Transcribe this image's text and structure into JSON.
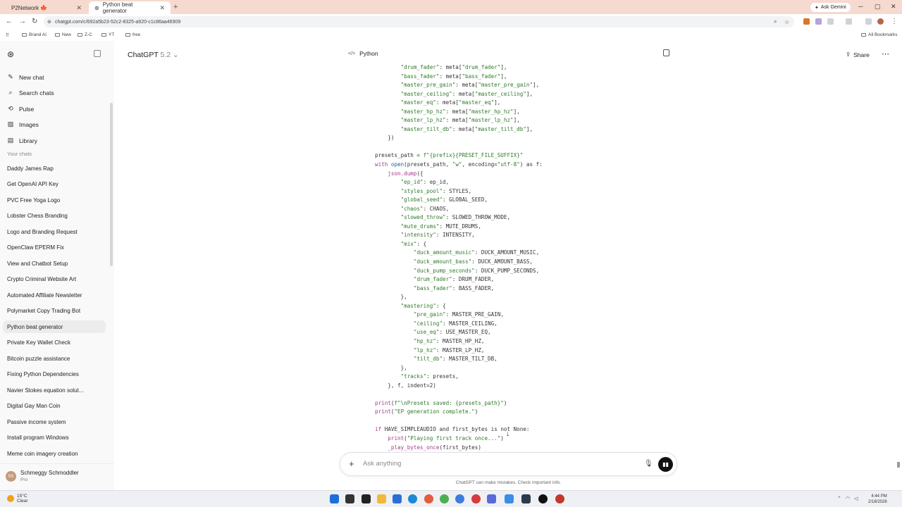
{
  "browser": {
    "tabs": [
      {
        "label": "P2Network 🍁",
        "active": false
      },
      {
        "label": "Python beat generator",
        "active": true
      }
    ],
    "url": "chatgpt.com/c/692a5b23-52c2-8325-a920-c1c86aa46909",
    "ask_gemini": "Ask Gemini",
    "bookmarks": [
      "Brand AI",
      "New",
      "Z-C",
      "YT",
      "free"
    ],
    "all_bookmarks": "All Bookmarks",
    "accent": "#f6d9cf"
  },
  "sidebar": {
    "nav": [
      {
        "label": "New chat",
        "icon": "edit-icon"
      },
      {
        "label": "Search chats",
        "icon": "search-icon"
      },
      {
        "label": "Pulse",
        "icon": "pulse-icon"
      },
      {
        "label": "Images",
        "icon": "image-icon"
      },
      {
        "label": "Library",
        "icon": "library-icon"
      }
    ],
    "section_label": "Your chats",
    "chats": [
      "Daddy James Rap",
      "Get OpenAI API Key",
      "PVC Free Yoga Logo",
      "Lobster Chess Branding",
      "Logo and Branding Request",
      "OpenClaw EPERM Fix",
      "View and Chatbot Setup",
      "Crypto Criminal Website Art",
      "Automated Affiliate Newsletter",
      "Polymarket Copy Trading Bot",
      "Python beat generator",
      "Private Key Wallet Check",
      "Bitcoin puzzle assistance",
      "Fixing Python Dependencies",
      "Navier Stokes equation solut...",
      "Digital Gay Man Coin",
      "Passive income system",
      "Install program Windows",
      "Meme coin imagery creation"
    ],
    "selected_chat": "Python beat generator",
    "user": {
      "name": "Schmeggy Schmoddler",
      "plan": "Pro",
      "initials": "SS"
    }
  },
  "header": {
    "model_name": "ChatGPT",
    "model_version": "5.2",
    "share_label": "Share"
  },
  "code_block": {
    "language": "Python",
    "lines": [
      "        \"drum_fader\": meta[\"drum_fader\"],",
      "        \"bass_fader\": meta[\"bass_fader\"],",
      "        \"master_pre_gain\": meta[\"master_pre_gain\"],",
      "        \"master_ceiling\": meta[\"master_ceiling\"],",
      "        \"master_eq\": meta[\"master_eq\"],",
      "        \"master_hp_hz\": meta[\"master_hp_hz\"],",
      "        \"master_lp_hz\": meta[\"master_lp_hz\"],",
      "        \"master_tilt_db\": meta[\"master_tilt_db\"],",
      "    })",
      "",
      "presets_path = f\"{prefix}{PRESET_FILE_SUFFIX}\"",
      "with open(presets_path, \"w\", encoding=\"utf-8\") as f:",
      "    json.dump({",
      "        \"ep_id\": ep_id,",
      "        \"styles_pool\": STYLES,",
      "        \"global_seed\": GLOBAL_SEED,",
      "        \"chaos\": CHAOS,",
      "        \"slowed_throw\": SLOWED_THROW_MODE,",
      "        \"mute_drums\": MUTE_DRUMS,",
      "        \"intensity\": INTENSITY,",
      "        \"mix\": {",
      "            \"duck_amount_music\": DUCK_AMOUNT_MUSIC,",
      "            \"duck_amount_bass\": DUCK_AMOUNT_BASS,",
      "            \"duck_pump_seconds\": DUCK_PUMP_SECONDS,",
      "            \"drum_fader\": DRUM_FADER,",
      "            \"bass_fader\": BASS_FADER,",
      "        },",
      "        \"mastering\": {",
      "            \"pre_gain\": MASTER_PRE_GAIN,",
      "            \"ceiling\": MASTER_CEILING,",
      "            \"use_eq\": USE_MASTER_EQ,",
      "            \"hp_hz\": MASTER_HP_HZ,",
      "            \"lp_hz\": MASTER_LP_HZ,",
      "            \"tilt_db\": MASTER_TILT_DB,",
      "        },",
      "        \"tracks\": presets,",
      "    }, f, indent=2)",
      "",
      "print(f\"\\nPresets saved: {presets_path}\")",
      "print(\"EP generation complete.\")",
      "",
      "if HAVE_SIMPLEAUDIO and first_bytes is not None:",
      "    print(\"Playing first track once...\")",
      "    _play_bytes_once(first_bytes)"
    ]
  },
  "composer": {
    "placeholder": "Ask anything",
    "disclaimer": "ChatGPT can make mistakes. Check important info."
  },
  "taskbar": {
    "weather_temp": "15°C",
    "weather_desc": "Clear",
    "time": "4:44 PM",
    "date": "2/18/2026"
  }
}
